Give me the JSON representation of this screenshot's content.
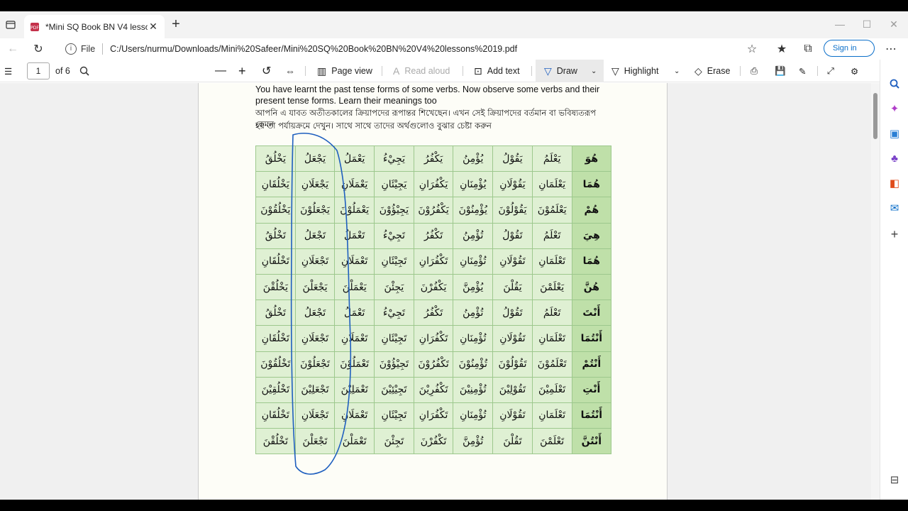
{
  "browser": {
    "tab_title": "*Mini SQ Book BN V4 lessons 19",
    "url_scheme_label": "File",
    "url": "C:/Users/nurmu/Downloads/Mini%20Safeer/Mini%20SQ%20Book%20BN%20V4%20lessons%2019.pdf",
    "sign_in_label": "Sign in"
  },
  "pdf_toolbar": {
    "page_number": "1",
    "page_count": "of 6",
    "page_view_label": "Page view",
    "read_aloud_label": "Read aloud",
    "add_text_label": "Add text",
    "draw_label": "Draw",
    "highlight_label": "Highlight",
    "erase_label": "Erase"
  },
  "document": {
    "intro_en_line1": "You have learnt the past tense forms of some verbs. Now observe some verbs and their",
    "intro_en_line2": "present tense forms. Learn their meanings too",
    "intro_bn_line1": "আপনি এ যাবত অতীতকালের ক্রিয়াপদের রূপান্তর শিখেছেন। এখন সেই ক্রিয়াপদের বর্তমান বা ভবিষ্যতরূপ কেমন",
    "intro_bn_line2": "হয় তা পর্যায়ক্রমে দেখুন। সাথে সাথে তাদের অর্থগুলোও বুঝার চেষ্টা করুন",
    "table_rows": [
      [
        "هُوَ",
        "يَعْلَمُ",
        "يَقُوْلُ",
        "يُؤْمِنُ",
        "يَكْفُرُ",
        "يَجِيْءُ",
        "يَعْمَلُ",
        "يَجْعَلُ",
        "يَخْلُقُ"
      ],
      [
        "هُمَا",
        "يَعْلَمَانِ",
        "يَقُوْلَانِ",
        "يُؤْمِنَانِ",
        "يَكْفُرَانِ",
        "يَجِيْئَانِ",
        "يَعْمَلَانِ",
        "يَجْعَلَانِ",
        "يَخْلُقَانِ"
      ],
      [
        "هُمْ",
        "يَعْلَمُوْنَ",
        "يَقُوْلُوْنَ",
        "يُؤْمِنُوْنَ",
        "يَكْفُرُوْنَ",
        "يَجِيْؤُوْنَ",
        "يَعْمَلُوْنَ",
        "يَجْعَلُوْنَ",
        "يَخْلُقُوْنَ"
      ],
      [
        "هِيَ",
        "تَعْلَمُ",
        "تَقُوْلُ",
        "تُؤْمِنُ",
        "تَكْفُرُ",
        "تَجِيْءُ",
        "تَعْمَلُ",
        "تَجْعَلُ",
        "تَخْلُقُ"
      ],
      [
        "هُمَا",
        "تَعْلَمَانِ",
        "تَقُوْلَانِ",
        "تُؤْمِنَانِ",
        "تَكْفُرَانِ",
        "تَجِيْئَانِ",
        "تَعْمَلَانِ",
        "تَجْعَلَانِ",
        "تَخْلُقَانِ"
      ],
      [
        "هُنَّ",
        "يَعْلَمْنَ",
        "يَقُلْنَ",
        "يُؤْمِنَّ",
        "يَكْفُرْنَ",
        "يَجِئْنَ",
        "يَعْمَلْنَ",
        "يَجْعَلْنَ",
        "يَخْلُقْنَ"
      ],
      [
        "أَنْتَ",
        "تَعْلَمُ",
        "تَقُوْلُ",
        "تُؤْمِنُ",
        "تَكْفُرُ",
        "تَجِيْءُ",
        "تَعْمَلُ",
        "تَجْعَلُ",
        "تَخْلُقُ"
      ],
      [
        "أَنْتُمَا",
        "تَعْلَمَانِ",
        "تَقُوْلَانِ",
        "تُؤْمِنَانِ",
        "تَكْفُرَانِ",
        "تَجِيْئَانِ",
        "تَعْمَلَانِ",
        "تَجْعَلَانِ",
        "تَخْلُقَانِ"
      ],
      [
        "أَنْتُمْ",
        "تَعْلَمُوْنَ",
        "تَقُوْلُوْنَ",
        "تُؤْمِنُوْنَ",
        "تَكْفُرُوْنَ",
        "تَجِيْؤُوْنَ",
        "تَعْمَلُوْنَ",
        "تَجْعَلُوْنَ",
        "تَخْلُقُوْنَ"
      ],
      [
        "أَنْتِ",
        "تَعْلَمِيْنَ",
        "تَقُوْلِيْنَ",
        "تُؤْمِنِيْنَ",
        "تَكْفُرِيْنَ",
        "تَجِيْئِيْنَ",
        "تَعْمَلِيْنَ",
        "تَجْعَلِيْنَ",
        "تَخْلُقِيْنَ"
      ],
      [
        "أَنْتُمَا",
        "تَعْلَمَانِ",
        "تَقُوْلَانِ",
        "تُؤْمِنَانِ",
        "تَكْفُرَانِ",
        "تَجِيْئَانِ",
        "تَعْمَلَانِ",
        "تَجْعَلَانِ",
        "تَخْلُقَانِ"
      ],
      [
        "أَنْتُنَّ",
        "تَعْلَمْنَ",
        "تَقُلْنَ",
        "تُؤْمِنَّ",
        "تَكْفُرْنَ",
        "تَجِئْنَ",
        "تَعْمَلْنَ",
        "تَجْعَلْنَ",
        "تَخْلُقْنَ"
      ]
    ]
  },
  "colors": {
    "ink_annotation": "#1f5fbf",
    "table_cell": "#dff0d3",
    "table_pronoun_cell": "#bfe0a9",
    "accent": "#0a6ec9"
  }
}
